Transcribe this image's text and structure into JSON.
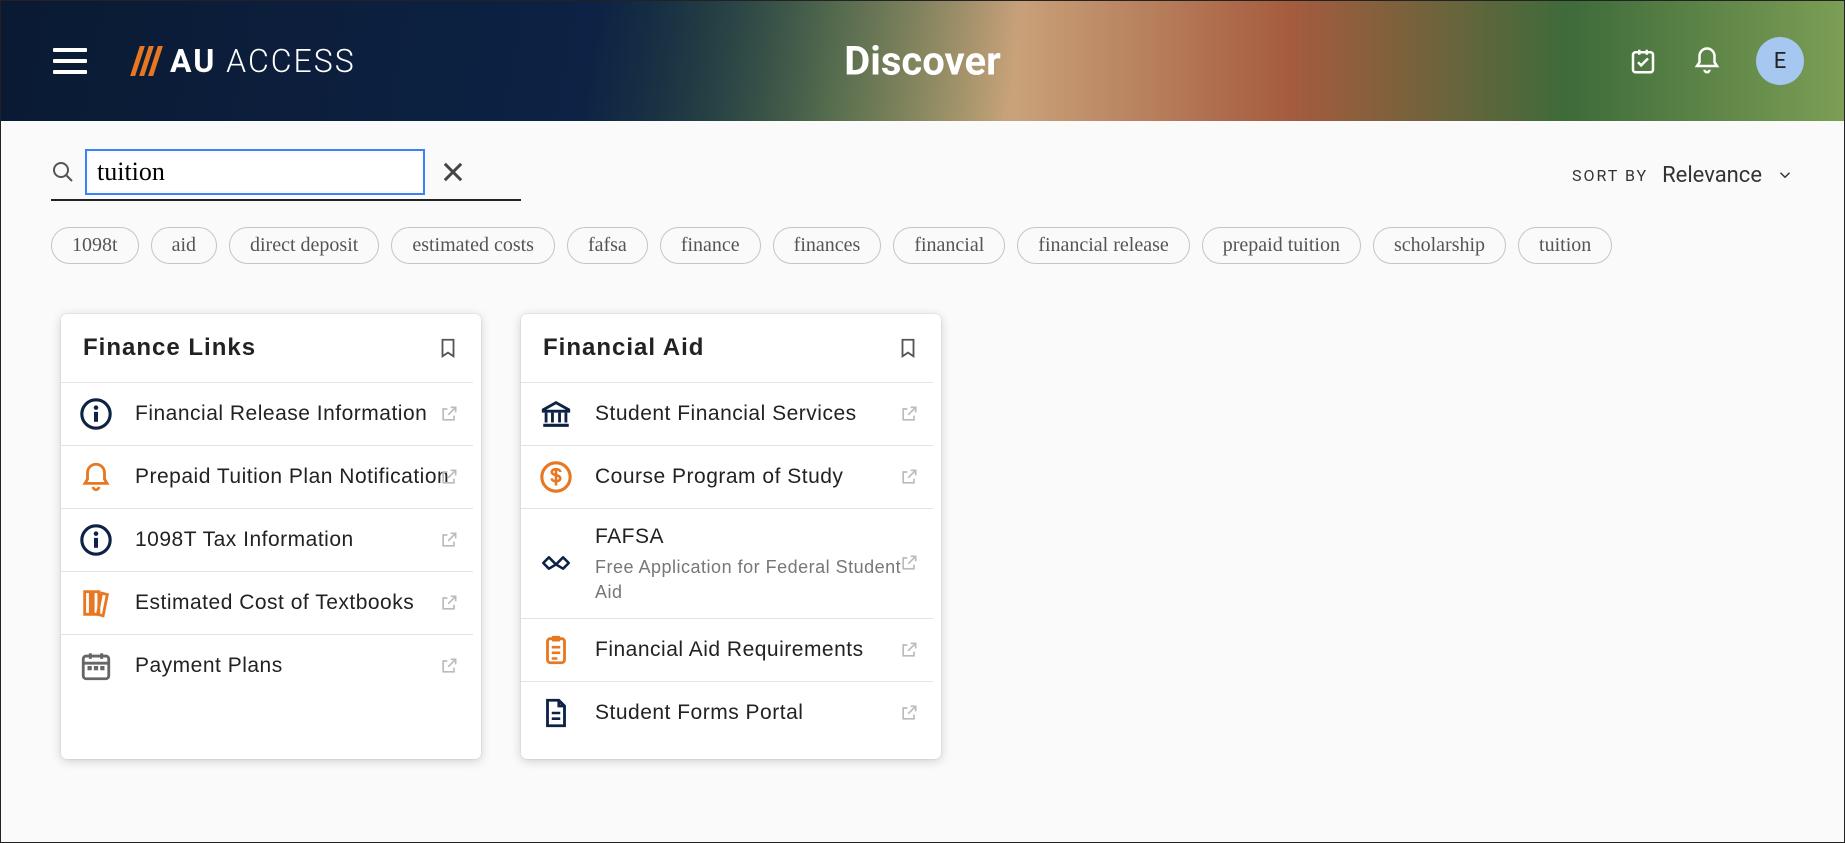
{
  "header": {
    "brand_bold": "AU",
    "brand_light": " ACCESS",
    "title": "Discover",
    "avatar_initial": "E"
  },
  "search": {
    "value": "tuition"
  },
  "sort": {
    "label": "Sort by",
    "value": "Relevance"
  },
  "chips": [
    "1098t",
    "aid",
    "direct deposit",
    "estimated costs",
    "fafsa",
    "finance",
    "finances",
    "financial",
    "financial release",
    "prepaid tuition",
    "scholarship",
    "tuition"
  ],
  "cards": [
    {
      "title": "Finance Links",
      "items": [
        {
          "icon": "info",
          "color": "navy",
          "label": "Financial Release Information"
        },
        {
          "icon": "bell",
          "color": "orange",
          "label": "Prepaid Tuition Plan Notification"
        },
        {
          "icon": "info",
          "color": "navy",
          "label": "1098T Tax Information"
        },
        {
          "icon": "books",
          "color": "orange",
          "label": "Estimated Cost of Textbooks"
        },
        {
          "icon": "calendar",
          "color": "gray",
          "label": "Payment Plans"
        }
      ]
    },
    {
      "title": "Financial Aid",
      "items": [
        {
          "icon": "bank",
          "color": "navy",
          "label": "Student Financial Services"
        },
        {
          "icon": "dollar",
          "color": "orange",
          "label": "Course Program of Study"
        },
        {
          "icon": "handshake",
          "color": "navy",
          "label": "FAFSA",
          "sub": "Free Application for Federal Student Aid"
        },
        {
          "icon": "clipboard",
          "color": "orange",
          "label": "Financial Aid Requirements"
        },
        {
          "icon": "doc",
          "color": "navy",
          "label": "Student Forms Portal"
        }
      ]
    }
  ]
}
